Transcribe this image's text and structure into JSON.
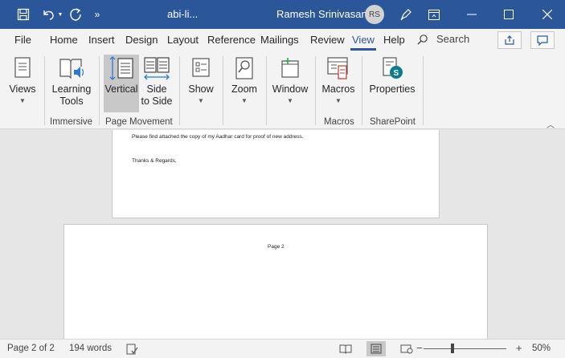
{
  "titlebar": {
    "doc_title": "abi-li...",
    "user_name": "Ramesh Srinivasan",
    "avatar_initials": "RS",
    "bg_color": "#2b579a"
  },
  "tabs": [
    {
      "label": "File"
    },
    {
      "label": "Home"
    },
    {
      "label": "Insert"
    },
    {
      "label": "Design"
    },
    {
      "label": "Layout"
    },
    {
      "label": "Reference"
    },
    {
      "label": "Mailings"
    },
    {
      "label": "Review"
    },
    {
      "label": "View",
      "active": true
    },
    {
      "label": "Help"
    }
  ],
  "search": {
    "label": "Search"
  },
  "ribbon": {
    "views_label": "Views",
    "learning_tools_label": "Learning Tools",
    "learning_tools_line1": "Learning",
    "learning_tools_line2": "Tools",
    "vertical_label": "Vertical",
    "side_to_side_line1": "Side",
    "side_to_side_line2": "to Side",
    "show_label": "Show",
    "zoom_label": "Zoom",
    "window_label": "Window",
    "macros_label": "Macros",
    "properties_label": "Properties",
    "groups": {
      "immersive": "Immersive",
      "page_movement": "Page Movement",
      "macros": "Macros",
      "sharepoint": "SharePoint"
    }
  },
  "document": {
    "page1_line1": "Please find attached the copy of my Aadhar card for proof of new address.",
    "page1_line2": "Thanks & Regards,",
    "page2_header": "Page 2"
  },
  "status": {
    "page_info": "Page 2 of 2",
    "word_count": "194 words",
    "zoom_level": "50%",
    "zoom_minus": "−",
    "zoom_plus": "+"
  }
}
